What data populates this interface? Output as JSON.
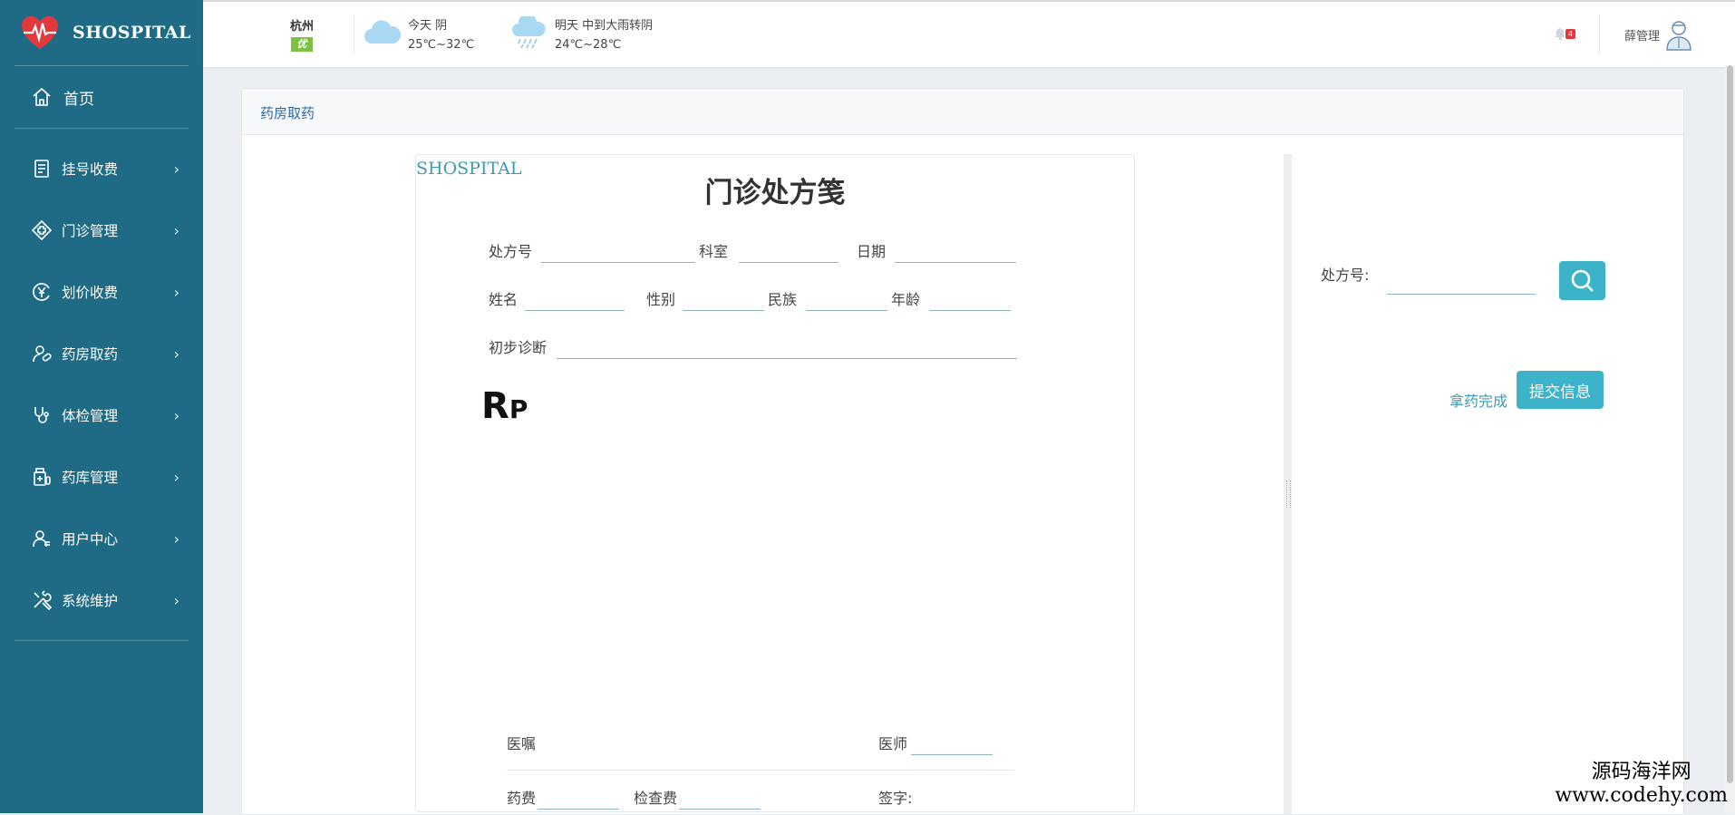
{
  "brand": {
    "name": "SHOSPITAL"
  },
  "sidebar": {
    "home": "首页",
    "items": [
      {
        "label": "挂号收费",
        "icon": "receipt-icon"
      },
      {
        "label": "门诊管理",
        "icon": "medical-cross-icon"
      },
      {
        "label": "划价收费",
        "icon": "yuan-coin-icon"
      },
      {
        "label": "药房取药",
        "icon": "pharmacy-user-icon"
      },
      {
        "label": "体检管理",
        "icon": "stethoscope-icon"
      },
      {
        "label": "药库管理",
        "icon": "medicine-bottle-icon"
      },
      {
        "label": "用户中心",
        "icon": "user-icon"
      },
      {
        "label": "系统维护",
        "icon": "tools-icon"
      }
    ]
  },
  "header": {
    "city": "杭州",
    "air_quality": "优",
    "today": {
      "label": "今天  阴",
      "temp": "25℃~32℃"
    },
    "tomorrow": {
      "label": "明天  中到大雨转阴",
      "temp": "24℃~28℃"
    },
    "notification_count": "4",
    "user_name": "薛管理"
  },
  "panel": {
    "title": "药房取药"
  },
  "prescription": {
    "brand": "SHOSPITAL",
    "title": "门诊处方笺",
    "fields": {
      "rx_no": "处方号",
      "dept": "科室",
      "date": "日期",
      "name": "姓名",
      "gender": "性别",
      "ethnicity": "民族",
      "age": "年龄",
      "diagnosis": "初步诊断",
      "advice": "医嘱",
      "doctor": "医师",
      "drug_fee": "药费",
      "exam_fee": "检查费",
      "signature": "签字:"
    },
    "rp_main": "R",
    "rp_sub": "P"
  },
  "search": {
    "label": "处方号:",
    "value": ""
  },
  "actions": {
    "done": "拿药完成",
    "submit": "提交信息"
  },
  "watermark": {
    "line1": "源码海洋网",
    "line2": "www.codehy.com"
  }
}
